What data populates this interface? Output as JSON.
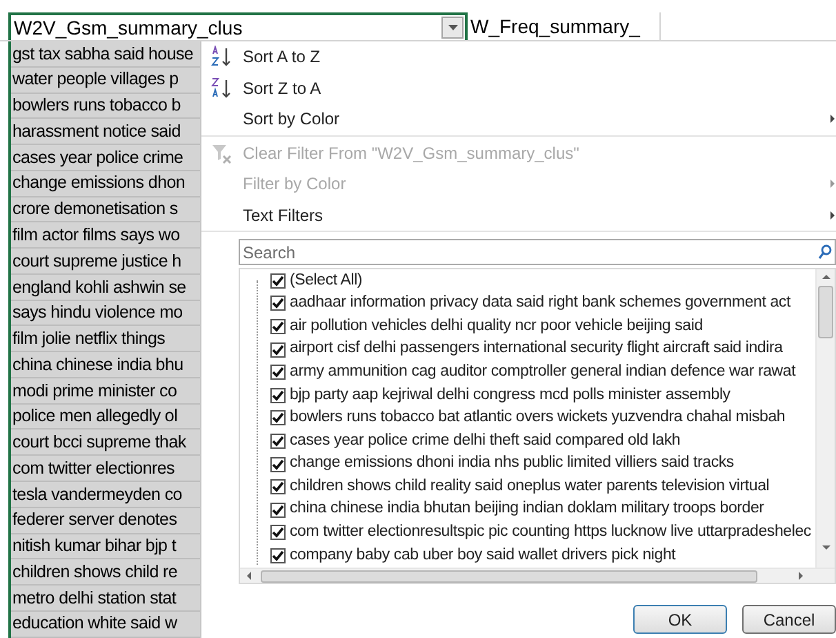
{
  "column_headers": [
    {
      "label": "W2V_Gsm_summary_clus",
      "filter_button": true
    },
    {
      "label": "W_Freq_summary_",
      "filter_button": false
    }
  ],
  "cells": [
    "gst tax sabha said house",
    "water people villages p",
    "bowlers runs tobacco b",
    "harassment notice said",
    "cases year police crime",
    "change emissions dhon",
    "crore demonetisation s",
    "film actor films says wo",
    "court supreme justice h",
    "england kohli ashwin se",
    "says hindu violence mo",
    "film jolie netflix things",
    "china chinese india bhu",
    "modi prime minister co",
    "police men allegedly ol",
    "court bcci supreme thak",
    "com twitter electionres",
    "tesla vandermeyden co",
    "federer server denotes",
    "nitish kumar bihar bjp t",
    "children shows child re",
    "metro delhi station stat",
    "education white said w"
  ],
  "filter_menu": {
    "groups": [
      [
        {
          "kind": "sort-asc",
          "label": "Sort A to Z",
          "disabled": false,
          "submenu": false
        },
        {
          "kind": "sort-desc",
          "label": "Sort Z to A",
          "disabled": false,
          "submenu": false
        },
        {
          "kind": "plain",
          "label": "Sort by Color",
          "disabled": false,
          "submenu": true
        }
      ],
      [
        {
          "kind": "clear-filter",
          "label": "Clear Filter From \"W2V_Gsm_summary_clus\"",
          "disabled": true,
          "submenu": false
        },
        {
          "kind": "plain",
          "label": "Filter by Color",
          "disabled": true,
          "submenu": true
        },
        {
          "kind": "plain",
          "label": "Text Filters",
          "disabled": false,
          "submenu": true
        }
      ]
    ],
    "search": {
      "placeholder": "Search"
    },
    "values": [
      {
        "label": "(Select All)",
        "checked": true
      },
      {
        "label": "aadhaar information privacy data said right bank schemes government act",
        "checked": true
      },
      {
        "label": "air pollution vehicles delhi quality ncr poor vehicle beijing said",
        "checked": true
      },
      {
        "label": "airport cisf delhi passengers international security flight aircraft said indira",
        "checked": true
      },
      {
        "label": "army ammunition cag auditor comptroller general indian defence war rawat",
        "checked": true
      },
      {
        "label": "bjp party aap kejriwal delhi congress mcd polls minister assembly",
        "checked": true
      },
      {
        "label": "bowlers runs tobacco bat atlantic overs wickets yuzvendra chahal misbah",
        "checked": true
      },
      {
        "label": "cases year police crime delhi theft said compared old lakh",
        "checked": true
      },
      {
        "label": "change emissions dhoni india nhs public limited villiers said tracks",
        "checked": true
      },
      {
        "label": "children shows child reality said oneplus water parents television virtual",
        "checked": true
      },
      {
        "label": "china chinese india bhutan beijing indian doklam military troops border",
        "checked": true
      },
      {
        "label": "com twitter electionresultspic pic counting https lucknow live uttarpradeshelec",
        "checked": true
      },
      {
        "label": "company baby cab uber boy said wallet drivers pick night",
        "checked": true
      }
    ],
    "buttons": [
      "OK",
      "Cancel"
    ]
  }
}
